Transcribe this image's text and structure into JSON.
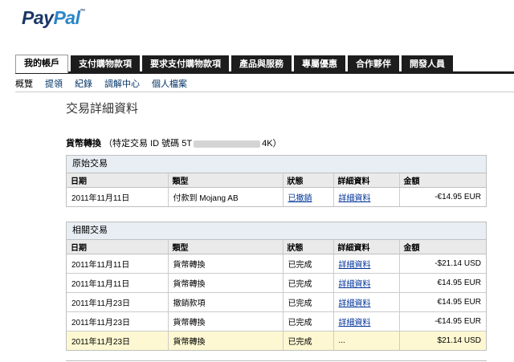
{
  "brand": {
    "pay": "Pay",
    "pal": "Pal",
    "tm": "™"
  },
  "tabs": [
    {
      "label": "我的帳戶",
      "active": true
    },
    {
      "label": "支付購物款項",
      "active": false
    },
    {
      "label": "要求支付購物款項",
      "active": false
    },
    {
      "label": "產品與服務",
      "active": false
    },
    {
      "label": "專屬優惠",
      "active": false
    },
    {
      "label": "合作夥伴",
      "active": false
    },
    {
      "label": "開發人員",
      "active": false
    }
  ],
  "subnav": [
    {
      "label": "概覽",
      "current": true
    },
    {
      "label": "提領",
      "current": false
    },
    {
      "label": "紀錄",
      "current": false
    },
    {
      "label": "調解中心",
      "current": false
    },
    {
      "label": "個人檔案",
      "current": false
    }
  ],
  "page_title": "交易詳細資料",
  "transaction": {
    "label": "貨幣轉換",
    "id_prefix": "（特定交易 ID 號碼 5T",
    "id_suffix": "4K）"
  },
  "columns": {
    "date": "日期",
    "type": "類型",
    "status": "狀態",
    "detail": "詳細資料",
    "amount": "金額"
  },
  "original": {
    "title": "原始交易",
    "rows": [
      {
        "date": "2011年11月11日",
        "type": "付款到 Mojang AB",
        "status": "已撤銷",
        "status_link": true,
        "detail": "詳細資料",
        "amount": "-€14.95 EUR"
      }
    ]
  },
  "related": {
    "title": "相關交易",
    "rows": [
      {
        "date": "2011年11月11日",
        "type": "貨幣轉換",
        "status": "已完成",
        "detail": "詳細資料",
        "amount": "-$21.14 USD",
        "highlight": false
      },
      {
        "date": "2011年11月11日",
        "type": "貨幣轉換",
        "status": "已完成",
        "detail": "詳細資料",
        "amount": "€14.95 EUR",
        "highlight": false
      },
      {
        "date": "2011年11月23日",
        "type": "撤銷款項",
        "status": "已完成",
        "detail": "詳細資料",
        "amount": "€14.95 EUR",
        "highlight": false
      },
      {
        "date": "2011年11月23日",
        "type": "貨幣轉換",
        "status": "已完成",
        "detail": "詳細資料",
        "amount": "-€14.95 EUR",
        "highlight": false
      },
      {
        "date": "2011年11月23日",
        "type": "貨幣轉換",
        "status": "已完成",
        "detail": "...",
        "amount": "$21.14 USD",
        "highlight": true
      }
    ]
  }
}
